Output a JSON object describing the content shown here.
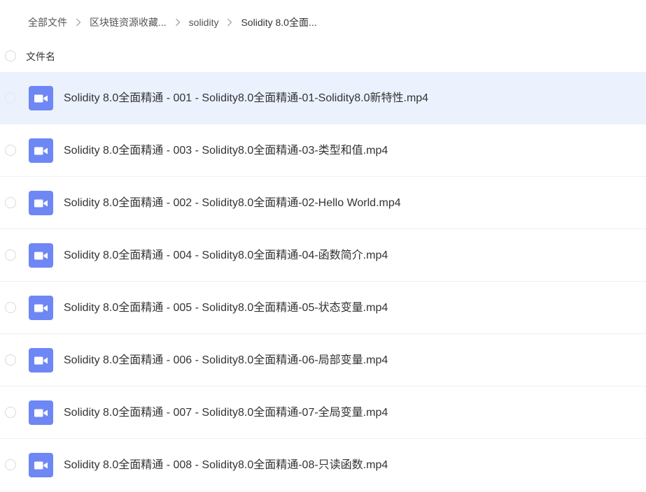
{
  "breadcrumb": {
    "items": [
      {
        "label": "全部文件"
      },
      {
        "label": "区块链资源收藏..."
      },
      {
        "label": "solidity"
      },
      {
        "label": "Solidity 8.0全面..."
      }
    ]
  },
  "list_header": {
    "name_label": "文件名"
  },
  "files": [
    {
      "name": "Solidity 8.0全面精通 - 001 - Solidity8.0全面精通-01-Solidity8.0新特性.mp4",
      "icon": "video-file-icon",
      "selected": true
    },
    {
      "name": "Solidity 8.0全面精通 - 003 - Solidity8.0全面精通-03-类型和值.mp4",
      "icon": "video-file-icon",
      "selected": false
    },
    {
      "name": "Solidity 8.0全面精通 - 002 - Solidity8.0全面精通-02-Hello World.mp4",
      "icon": "video-file-icon",
      "selected": false
    },
    {
      "name": "Solidity 8.0全面精通 - 004 - Solidity8.0全面精通-04-函数简介.mp4",
      "icon": "video-file-icon",
      "selected": false
    },
    {
      "name": "Solidity 8.0全面精通 - 005 - Solidity8.0全面精通-05-状态变量.mp4",
      "icon": "video-file-icon",
      "selected": false
    },
    {
      "name": "Solidity 8.0全面精通 - 006 - Solidity8.0全面精通-06-局部变量.mp4",
      "icon": "video-file-icon",
      "selected": false
    },
    {
      "name": "Solidity 8.0全面精通 - 007 - Solidity8.0全面精通-07-全局变量.mp4",
      "icon": "video-file-icon",
      "selected": false
    },
    {
      "name": "Solidity 8.0全面精通 - 008 - Solidity8.0全面精通-08-只读函数.mp4",
      "icon": "video-file-icon",
      "selected": false
    }
  ],
  "colors": {
    "selected_row": "#ebf2fd",
    "video_icon": "#6e87f5",
    "divider": "#f0f0f0"
  }
}
